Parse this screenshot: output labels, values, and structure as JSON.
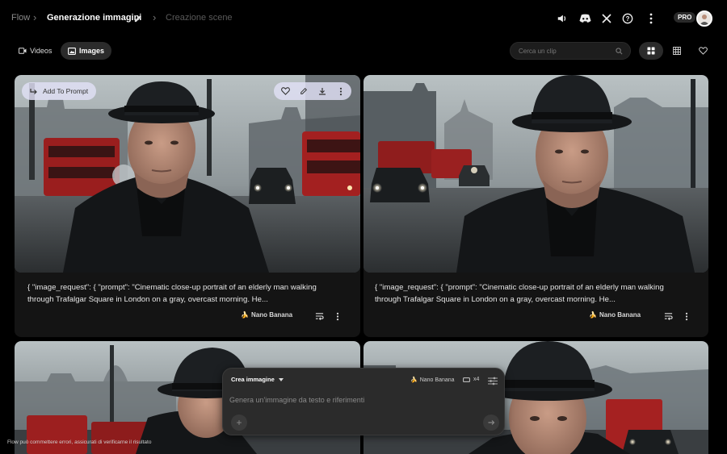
{
  "breadcrumb": {
    "root": "Flow",
    "project": "Generazione immagini",
    "scene": "Creazione scene"
  },
  "header": {
    "pro_label": "PRO",
    "icons": [
      "speaker-icon",
      "discord-icon",
      "x-icon",
      "help-icon",
      "more-icon"
    ]
  },
  "tabs": [
    {
      "label": "Videos",
      "active": false
    },
    {
      "label": "Images",
      "active": true
    }
  ],
  "search": {
    "placeholder": "Cerca un clip"
  },
  "view_toggle": [
    "grid-large",
    "grid-small",
    "favorites"
  ],
  "card_toolbar": {
    "add_to_prompt": "Add To Prompt"
  },
  "cards": [
    {
      "caption": "{ \"image_request\": { \"prompt\": \"Cinematic close-up portrait of an elderly man walking through Trafalgar Square in London on a gray, overcast morning. He...",
      "model": "Nano Banana"
    },
    {
      "caption": "{ \"image_request\": { \"prompt\": \"Cinematic close-up portrait of an elderly man walking through Trafalgar Square in London on a gray, overcast morning. He...",
      "model": "Nano Banana"
    }
  ],
  "composer": {
    "mode": "Crea immagine",
    "model": "Nano Banana",
    "count": "x4",
    "placeholder": "Genera un'immagine da testo e riferimenti"
  },
  "disclaimer": "Flow può commettere errori, assicurati di verificarne il risultato"
}
